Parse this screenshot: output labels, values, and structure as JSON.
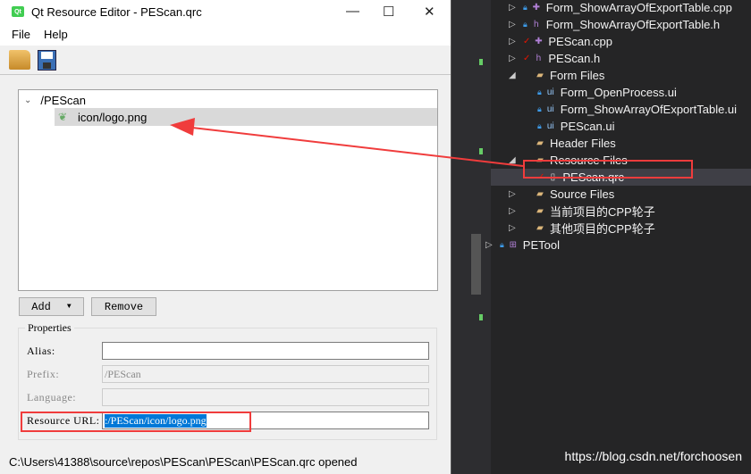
{
  "window": {
    "title": "Qt Resource Editor - PEScan.qrc",
    "logo": "Qt",
    "minimize": "—",
    "maximize": "☐",
    "close": "✕"
  },
  "menu": [
    "File",
    "Help"
  ],
  "toolbar": {
    "open_icon": "folder-open-icon",
    "save_icon": "save-disk-icon"
  },
  "tree": {
    "prefix": "/PEScan",
    "file": "icon/logo.png"
  },
  "buttons": {
    "add": "Add",
    "add_arrow": "▼",
    "remove": "Remove"
  },
  "properties": {
    "title": "Properties",
    "alias_label": "Alias:",
    "alias_value": "",
    "prefix_label": "Prefix:",
    "prefix_value": "/PEScan",
    "language_label": "Language:",
    "language_value": "",
    "url_label": "Resource URL:",
    "url_value": ":/PEScan/icon/logo.png"
  },
  "status": "C:\\Users\\41388\\source\\repos\\PEScan\\PEScan\\PEScan.qrc opened",
  "solution_explorer": {
    "items": [
      {
        "label": "Form_ShowArrayOfExportTable.cpp",
        "icon": "++",
        "lock": true
      },
      {
        "label": "Form_ShowArrayOfExportTable.h",
        "icon": "h",
        "lock": true
      },
      {
        "label": "PEScan.cpp",
        "icon": "++",
        "check": true
      },
      {
        "label": "PEScan.h",
        "icon": "h",
        "check": true
      },
      {
        "label": "Form Files",
        "icon": "folder"
      },
      {
        "label": "Form_OpenProcess.ui",
        "icon": "ui",
        "lock": true
      },
      {
        "label": "Form_ShowArrayOfExportTable.ui",
        "icon": "ui",
        "lock": true
      },
      {
        "label": "PEScan.ui",
        "icon": "ui",
        "lock": true
      },
      {
        "label": "Header Files",
        "icon": "folder"
      },
      {
        "label": "Resource Files",
        "icon": "folder"
      },
      {
        "label": "PEScan.qrc",
        "icon": "file",
        "check": true
      },
      {
        "label": "Source Files",
        "icon": "folder"
      },
      {
        "label": "当前项目的CPP轮子",
        "icon": "folder"
      },
      {
        "label": "其他项目的CPP轮子",
        "icon": "folder"
      },
      {
        "label": "PETool",
        "icon": "project",
        "lock": true
      }
    ]
  },
  "watermark": "https://blog.csdn.net/forchoosen",
  "colors": {
    "annotation": "#f03c3c",
    "selection": "#0078d7"
  }
}
